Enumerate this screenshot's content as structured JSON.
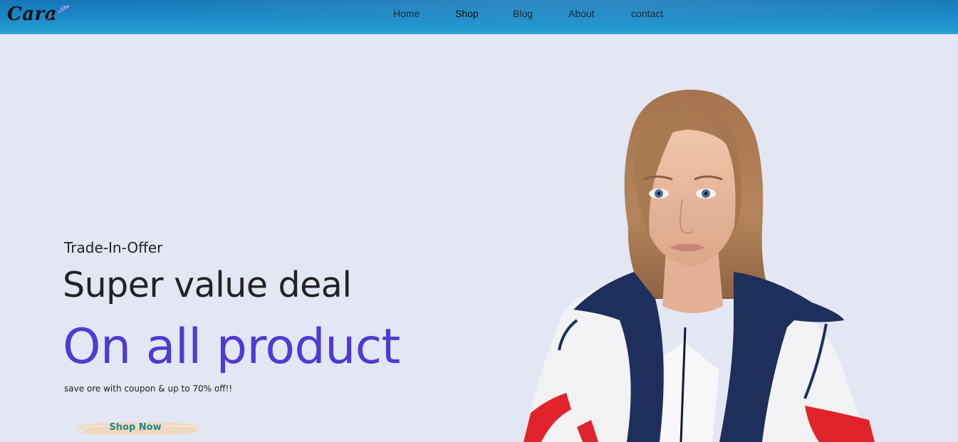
{
  "header": {
    "logo_text": "Cara",
    "nav": [
      {
        "label": "Home"
      },
      {
        "label": "Shop"
      },
      {
        "label": "Blog"
      },
      {
        "label": "About"
      },
      {
        "label": "contact"
      }
    ],
    "active_nav": "Shop"
  },
  "hero": {
    "eyebrow": "Trade-In-Offer",
    "subheading": "Super value deal",
    "heading": "On all product",
    "description": "save ore with coupon & up to 70% off!!",
    "button_label": "Shop Now"
  },
  "colors": {
    "header": "#1b8cc8",
    "background": "#e3e6f3",
    "accent": "#5139d4",
    "button_text": "#1f8a85",
    "button_brush": "#f1d9c0"
  },
  "icons": {
    "logo_sprig": "lavender-sprig-icon"
  }
}
